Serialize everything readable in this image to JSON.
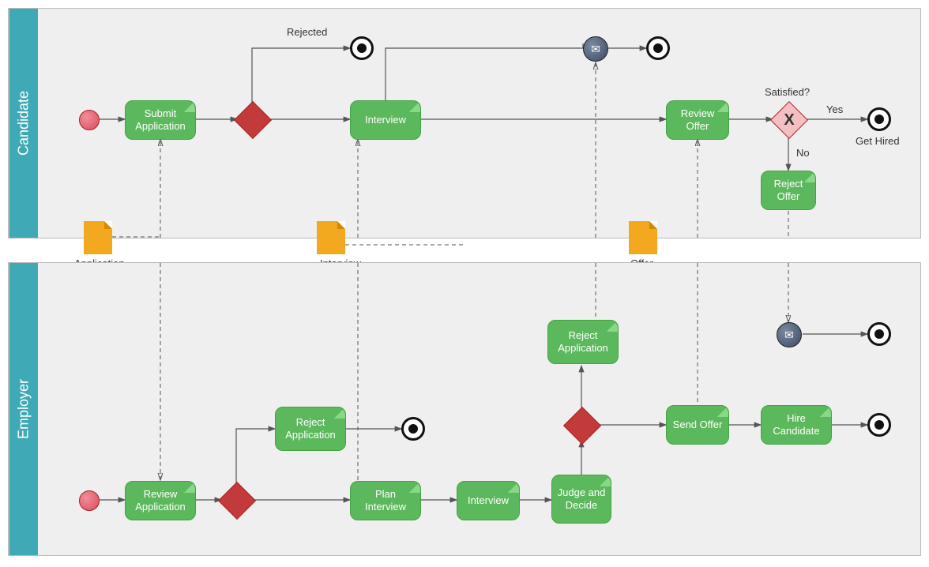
{
  "pools": {
    "candidate": "Candidate",
    "employer": "Employer"
  },
  "candidate": {
    "submit": "Submit Application",
    "interview": "Interview",
    "reviewOffer": "Review Offer",
    "rejectOffer": "Reject Offer",
    "rejectedLabel": "Rejected",
    "satisfied": "Satisfied?",
    "yes": "Yes",
    "no": "No",
    "getHired": "Get Hired"
  },
  "employer": {
    "reviewApp": "Review Application",
    "rejectApp1": "Reject Application",
    "planInterview": "Plan Interview",
    "interview": "Interview",
    "judge": "Judge and Decide",
    "rejectApp2": "Reject Application",
    "sendOffer": "Send Offer",
    "hire": "Hire Candidate"
  },
  "artifacts": {
    "application": "Application",
    "interviewInvitation": "Interview Invitation",
    "offer": "Offer"
  }
}
